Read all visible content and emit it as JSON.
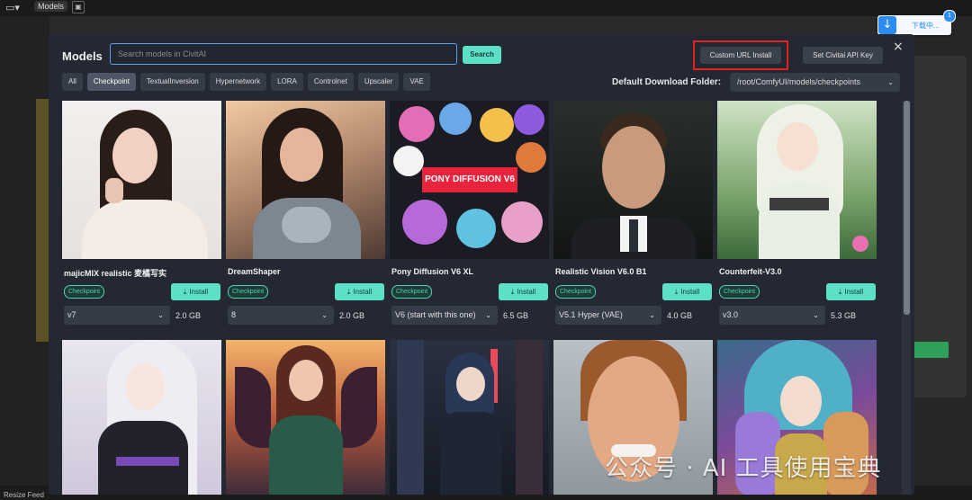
{
  "app": {
    "topbar_models_label": "Models",
    "bottom_left_label": "Resize Feed",
    "download_button": {
      "text": "下载中...",
      "badge": "1"
    },
    "watermark": "公众号 · AI 工具使用宝典"
  },
  "modal": {
    "title": "Models",
    "search": {
      "placeholder": "Search models in CivitAI",
      "value": "",
      "button_label": "Search"
    },
    "custom_url_install_label": "Custom URL Install",
    "set_api_key_label": "Set Civitai API Key",
    "close_symbol": "×",
    "tabs": [
      "All",
      "Checkpoint",
      "TextualInversion",
      "Hypernetwork",
      "LORA",
      "Controlnet",
      "Upscaler",
      "VAE"
    ],
    "active_tab": "Checkpoint",
    "default_folder_label": "Default Download Folder:",
    "default_folder_value": "/root/ComfyUI/models/checkpoints",
    "install_label": "Install",
    "cards": [
      {
        "name": "majicMIX realistic 麦橘写实",
        "type": "Checkpoint",
        "version": "v7",
        "size": "2.0 GB"
      },
      {
        "name": "DreamShaper",
        "type": "Checkpoint",
        "version": "8",
        "size": "2.0 GB"
      },
      {
        "name": "Pony Diffusion V6 XL",
        "type": "Checkpoint",
        "version": "V6 (start with this one)",
        "size": "6.5 GB",
        "thumb_text": "PONY DIFFUSION V6"
      },
      {
        "name": "Realistic Vision V6.0 B1",
        "type": "Checkpoint",
        "version": "V5.1 Hyper (VAE)",
        "size": "4.0 GB"
      },
      {
        "name": "Counterfeit-V3.0",
        "type": "Checkpoint",
        "version": "v3.0",
        "size": "5.3 GB"
      }
    ],
    "colors": {
      "accent": "#5ce1c6",
      "highlight_box": "#e52222",
      "modal_bg": "#232833"
    }
  }
}
